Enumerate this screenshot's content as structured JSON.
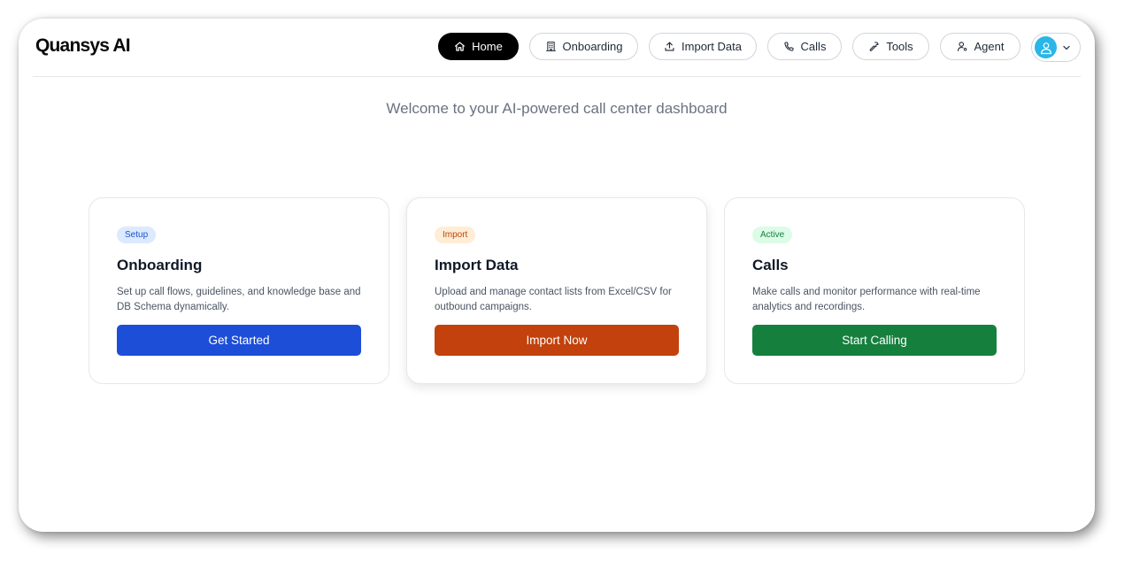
{
  "app": {
    "logo": "Quansys AI"
  },
  "nav": {
    "items": [
      {
        "label": "Home",
        "icon": "home-icon",
        "active": true
      },
      {
        "label": "Onboarding",
        "icon": "building-icon",
        "active": false
      },
      {
        "label": "Import Data",
        "icon": "upload-icon",
        "active": false
      },
      {
        "label": "Calls",
        "icon": "phone-icon",
        "active": false
      },
      {
        "label": "Tools",
        "icon": "wrench-icon",
        "active": false
      },
      {
        "label": "Agent",
        "icon": "user-gear-icon",
        "active": false
      }
    ],
    "avatar_icon": "user-avatar-icon"
  },
  "main": {
    "subtitle": "Welcome to your AI-powered call center dashboard",
    "cards": [
      {
        "badge": "Setup",
        "title": "Onboarding",
        "description": "Set up call flows, guidelines, and knowledge base and DB Schema dynamically.",
        "button": "Get Started",
        "button_color": "#1d4ed8",
        "badge_bg": "#dbeafe",
        "badge_fg": "#1d4ed8"
      },
      {
        "badge": "Import",
        "title": "Import Data",
        "description": "Upload and manage contact lists from Excel/CSV for outbound campaigns.",
        "button": "Import Now",
        "button_color": "#c2410c",
        "badge_bg": "#ffedd5",
        "badge_fg": "#c2410c"
      },
      {
        "badge": "Active",
        "title": "Calls",
        "description": "Make calls and monitor performance with real-time analytics and recordings.",
        "button": "Start Calling",
        "button_color": "#15803d",
        "badge_bg": "#dcfce7",
        "badge_fg": "#15803d"
      }
    ]
  }
}
